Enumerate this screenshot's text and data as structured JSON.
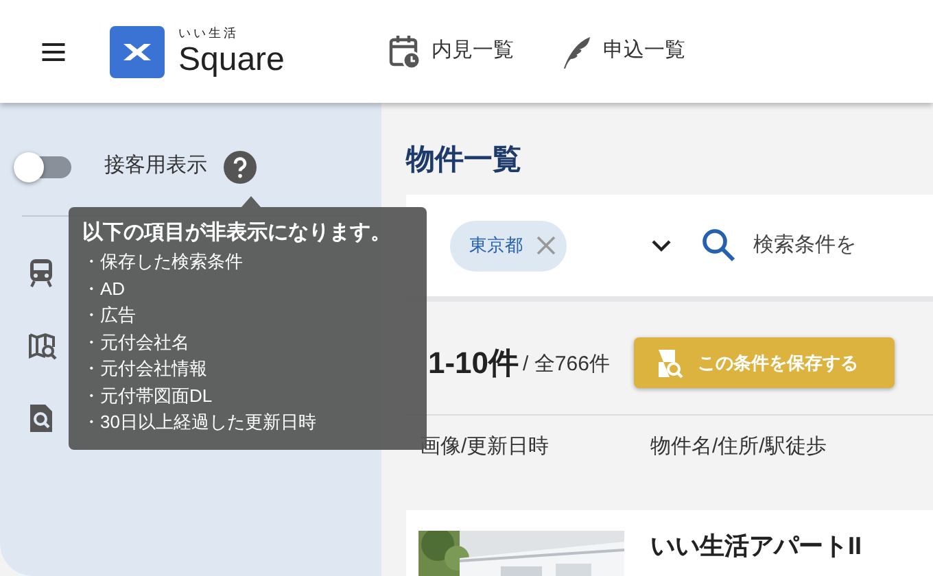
{
  "header": {
    "logo": {
      "tagline": "いい生活",
      "name": "Square"
    },
    "nav": [
      {
        "label": "内見一覧"
      },
      {
        "label": "申込一覧"
      }
    ]
  },
  "sidebar": {
    "customer_view": {
      "label": "接客用表示",
      "on": false
    }
  },
  "tooltip": {
    "title": "以下の項目が非表示になります。",
    "items": [
      "・保存した検索条件",
      "・AD",
      "・広告",
      "・元付会社名",
      "・元付会社情報",
      "・元付帯図面DL",
      "・30日以上経過した更新日時"
    ]
  },
  "main": {
    "title": "物件一覧",
    "search": {
      "chips": [
        {
          "label": "東京都"
        }
      ],
      "placeholder": "検索条件を"
    },
    "results": {
      "range": "1-10件",
      "total": "/ 全766件"
    },
    "save_button": "この条件を保存する",
    "columns": [
      "画像/更新日時",
      "物件名/住所/駅徒歩"
    ],
    "listings": [
      {
        "title": "いい生活アパートII",
        "kind": "picture"
      }
    ]
  }
}
